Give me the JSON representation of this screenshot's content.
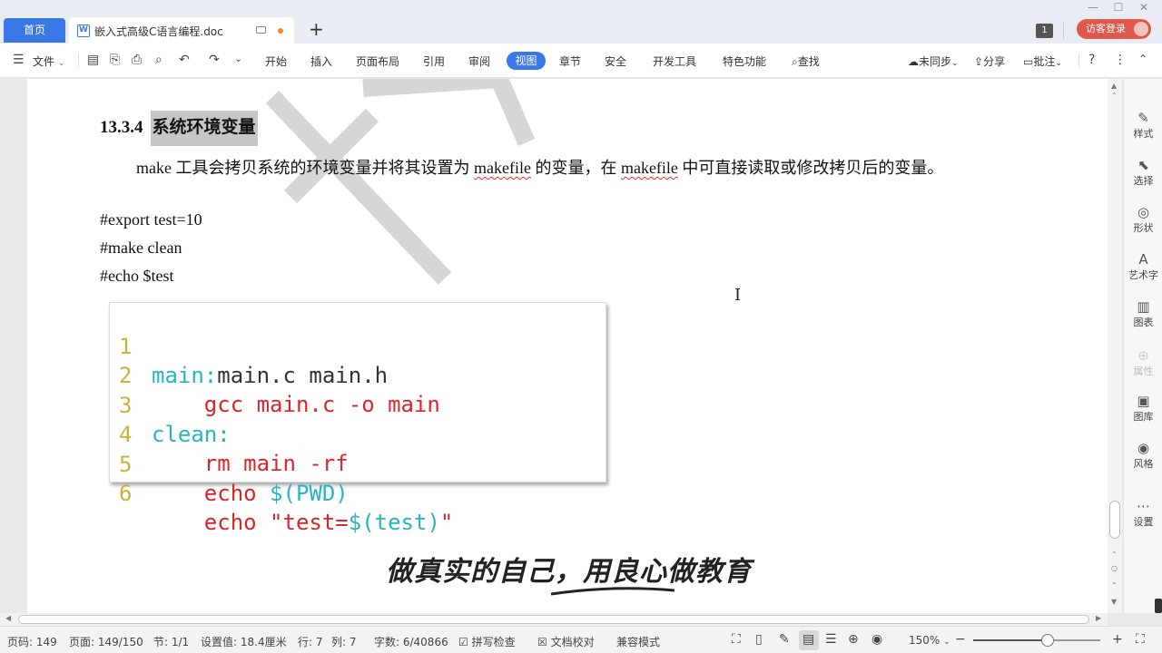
{
  "titlebar": {
    "home_tab": "首页",
    "doc_tab": "嵌入式高级C语言编程.doc",
    "doc_icon": "W",
    "add_tab": "+",
    "badge": "1",
    "login": "访客登录",
    "win_min": "—",
    "win_max": "☐",
    "win_close": "✕"
  },
  "menubar": {
    "file": "文件",
    "tabs": [
      "开始",
      "插入",
      "页面布局",
      "引用",
      "审阅",
      "视图",
      "章节",
      "安全",
      "开发工具",
      "特色功能"
    ],
    "active_tab": "视图",
    "search": "查找",
    "sync": "未同步",
    "share": "分享",
    "comment": "批注",
    "help": "?"
  },
  "document": {
    "heading_number": "13.3.4",
    "heading_text": "系统环境变量",
    "para_pre": "make 工具会拷贝系统的环境变量并将其设置为 ",
    "para_word1": "makefile",
    "para_mid": " 的变量，在 ",
    "para_word2": "makefile",
    "para_post": " 中可直接读取或修改拷贝后的变量。",
    "commands": [
      "#export test=10",
      "#make clean",
      "#echo $test"
    ],
    "code_lines": [
      {
        "n": "1",
        "a": "main:",
        "b": "main.c main.h",
        "c": "",
        "d": "",
        "e": ""
      },
      {
        "n": "2",
        "a": "",
        "b": "",
        "c": "    gcc main.c -o main",
        "d": "",
        "e": ""
      },
      {
        "n": "3",
        "a": "clean:",
        "b": "",
        "c": "",
        "d": "",
        "e": ""
      },
      {
        "n": "4",
        "a": "",
        "b": "",
        "c": "    rm main -rf",
        "d": "",
        "e": ""
      },
      {
        "n": "5",
        "a": "",
        "b": "",
        "c": "    echo ",
        "d": "$(PWD)",
        "e": ""
      },
      {
        "n": "6",
        "a": "",
        "b": "",
        "c": "    echo \"test=",
        "d": "$(test)",
        "e": "\""
      }
    ],
    "slogan": "做真实的自己，用良心做教育"
  },
  "sidebar": {
    "items": [
      {
        "label": "样式",
        "icon": "✎"
      },
      {
        "label": "选择",
        "icon": "⬉"
      },
      {
        "label": "形状",
        "icon": "◎"
      },
      {
        "label": "艺术字",
        "icon": "A"
      },
      {
        "label": "图表",
        "icon": "▥"
      },
      {
        "label": "属性",
        "icon": "⊕"
      },
      {
        "label": "图库",
        "icon": "▣"
      },
      {
        "label": "风格",
        "icon": "◉"
      },
      {
        "label": "设置",
        "icon": "⋯"
      }
    ]
  },
  "statusbar": {
    "page_code": "页码: 149",
    "page": "页面: 149/150",
    "section": "节: 1/1",
    "setting": "设置值: 18.4厘米",
    "row": "行: 7",
    "col": "列: 7",
    "words": "字数: 6/40866",
    "spell": "拼写检查",
    "proof": "文档校对",
    "compat": "兼容模式",
    "zoom": "150%",
    "zoom_level_percent": 58
  },
  "colors": {
    "accent": "#3b78e7",
    "login": "#e0574c",
    "code_cyan": "#27b5c5",
    "code_red": "#d8262b",
    "line_number": "#c9b23c"
  }
}
